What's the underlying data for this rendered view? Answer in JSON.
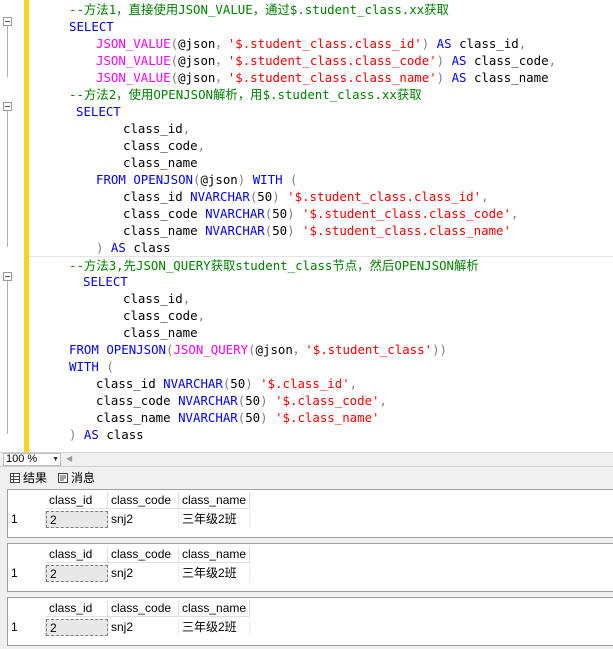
{
  "editor": {
    "lines": [
      [
        {
          "t": "--方法1，直接使用JSON_VALUE，通过$.student_class.xx获取",
          "c": "c"
        }
      ],
      [
        {
          "t": "SELECT",
          "c": "k"
        }
      ],
      [
        {
          "t": "JSON_VALUE",
          "c": "f"
        },
        {
          "t": "(",
          "c": "g"
        },
        {
          "t": "@json",
          "c": "t"
        },
        {
          "t": "，",
          "c": "g"
        },
        {
          "t": "'$.student_class.class_id'",
          "c": "s"
        },
        {
          "t": ")",
          "c": "g"
        },
        {
          "t": " AS ",
          "c": "k"
        },
        {
          "t": "class_id",
          "c": "t"
        },
        {
          "t": ",",
          "c": "g"
        }
      ],
      [
        {
          "t": "JSON_VALUE",
          "c": "f"
        },
        {
          "t": "(",
          "c": "g"
        },
        {
          "t": "@json",
          "c": "t"
        },
        {
          "t": "，",
          "c": "g"
        },
        {
          "t": "'$.student_class.class_code'",
          "c": "s"
        },
        {
          "t": ")",
          "c": "g"
        },
        {
          "t": " AS ",
          "c": "k"
        },
        {
          "t": "class_code",
          "c": "t"
        },
        {
          "t": ",",
          "c": "g"
        }
      ],
      [
        {
          "t": "JSON_VALUE",
          "c": "f"
        },
        {
          "t": "(",
          "c": "g"
        },
        {
          "t": "@json",
          "c": "t"
        },
        {
          "t": "，",
          "c": "g"
        },
        {
          "t": "'$.student_class.class_name'",
          "c": "s"
        },
        {
          "t": ")",
          "c": "g"
        },
        {
          "t": " AS ",
          "c": "k"
        },
        {
          "t": "class_name",
          "c": "t"
        }
      ],
      [
        {
          "t": "--方法2，使用OPENJSON解析，用$.student_class.xx获取",
          "c": "c"
        }
      ],
      [
        {
          "t": "SELECT",
          "c": "k"
        }
      ],
      [
        {
          "t": "class_id",
          "c": "t"
        },
        {
          "t": ",",
          "c": "g"
        }
      ],
      [
        {
          "t": "class_code",
          "c": "t"
        },
        {
          "t": ",",
          "c": "g"
        }
      ],
      [
        {
          "t": "class_name",
          "c": "t"
        }
      ],
      [
        {
          "t": "FROM ",
          "c": "k"
        },
        {
          "t": "OPENJSON",
          "c": "k"
        },
        {
          "t": "(",
          "c": "g"
        },
        {
          "t": "@json",
          "c": "t"
        },
        {
          "t": ")",
          "c": "g"
        },
        {
          "t": " WITH ",
          "c": "k"
        },
        {
          "t": "(",
          "c": "g"
        }
      ],
      [
        {
          "t": "class_id ",
          "c": "t"
        },
        {
          "t": "NVARCHAR",
          "c": "k"
        },
        {
          "t": "(",
          "c": "g"
        },
        {
          "t": "50",
          "c": "t"
        },
        {
          "t": ")",
          "c": "g"
        },
        {
          "t": " '$.student_class.class_id'",
          "c": "s"
        },
        {
          "t": ",",
          "c": "g"
        }
      ],
      [
        {
          "t": "class_code ",
          "c": "t"
        },
        {
          "t": "NVARCHAR",
          "c": "k"
        },
        {
          "t": "(",
          "c": "g"
        },
        {
          "t": "50",
          "c": "t"
        },
        {
          "t": ")",
          "c": "g"
        },
        {
          "t": " '$.student_class.class_code'",
          "c": "s"
        },
        {
          "t": ",",
          "c": "g"
        }
      ],
      [
        {
          "t": "class_name ",
          "c": "t"
        },
        {
          "t": "NVARCHAR",
          "c": "k"
        },
        {
          "t": "(",
          "c": "g"
        },
        {
          "t": "50",
          "c": "t"
        },
        {
          "t": ")",
          "c": "g"
        },
        {
          "t": " '$.student_class.class_name'",
          "c": "s"
        }
      ],
      [
        {
          "t": ")",
          "c": "g"
        },
        {
          "t": " AS ",
          "c": "k"
        },
        {
          "t": "class",
          "c": "t"
        }
      ],
      [
        {
          "t": "--方法3,先JSON_QUERY获取student_class节点，然后OPENJSON解析",
          "c": "c"
        }
      ],
      [
        {
          "t": "SELECT",
          "c": "k"
        }
      ],
      [
        {
          "t": "class_id",
          "c": "t"
        },
        {
          "t": ",",
          "c": "g"
        }
      ],
      [
        {
          "t": "class_code",
          "c": "t"
        },
        {
          "t": ",",
          "c": "g"
        }
      ],
      [
        {
          "t": "class_name",
          "c": "t"
        }
      ],
      [
        {
          "t": "FROM ",
          "c": "k"
        },
        {
          "t": "OPENJSON",
          "c": "k"
        },
        {
          "t": "(",
          "c": "g"
        },
        {
          "t": "JSON_QUERY",
          "c": "f"
        },
        {
          "t": "(",
          "c": "g"
        },
        {
          "t": "@json",
          "c": "t"
        },
        {
          "t": "，",
          "c": "g"
        },
        {
          "t": "'$.student_class'",
          "c": "s"
        },
        {
          "t": "))",
          "c": "g"
        }
      ],
      [
        {
          "t": "WITH ",
          "c": "k"
        },
        {
          "t": "(",
          "c": "g"
        }
      ],
      [
        {
          "t": "class_id ",
          "c": "t"
        },
        {
          "t": "NVARCHAR",
          "c": "k"
        },
        {
          "t": "(",
          "c": "g"
        },
        {
          "t": "50",
          "c": "t"
        },
        {
          "t": ")",
          "c": "g"
        },
        {
          "t": " '$.class_id'",
          "c": "s"
        },
        {
          "t": ",",
          "c": "g"
        }
      ],
      [
        {
          "t": "class_code ",
          "c": "t"
        },
        {
          "t": "NVARCHAR",
          "c": "k"
        },
        {
          "t": "(",
          "c": "g"
        },
        {
          "t": "50",
          "c": "t"
        },
        {
          "t": ")",
          "c": "g"
        },
        {
          "t": " '$.class_code'",
          "c": "s"
        },
        {
          "t": ",",
          "c": "g"
        }
      ],
      [
        {
          "t": "class_name ",
          "c": "t"
        },
        {
          "t": "NVARCHAR",
          "c": "k"
        },
        {
          "t": "(",
          "c": "g"
        },
        {
          "t": "50",
          "c": "t"
        },
        {
          "t": ")",
          "c": "g"
        },
        {
          "t": " '$.class_name'",
          "c": "s"
        }
      ],
      [
        {
          "t": ")",
          "c": "g"
        },
        {
          "t": " AS ",
          "c": "k"
        },
        {
          "t": "class",
          "c": "t"
        }
      ]
    ]
  },
  "zoom": {
    "value": "100 %"
  },
  "tabs": {
    "results": "结果",
    "messages": "消息"
  },
  "results": {
    "columns": [
      "class_id",
      "class_code",
      "class_name"
    ],
    "grids": [
      {
        "row_num": "1",
        "cells": [
          "2",
          "snj2",
          "三年级2班"
        ]
      },
      {
        "row_num": "1",
        "cells": [
          "2",
          "snj2",
          "三年级2班"
        ]
      },
      {
        "row_num": "1",
        "cells": [
          "2",
          "snj2",
          "三年级2班"
        ]
      }
    ]
  }
}
